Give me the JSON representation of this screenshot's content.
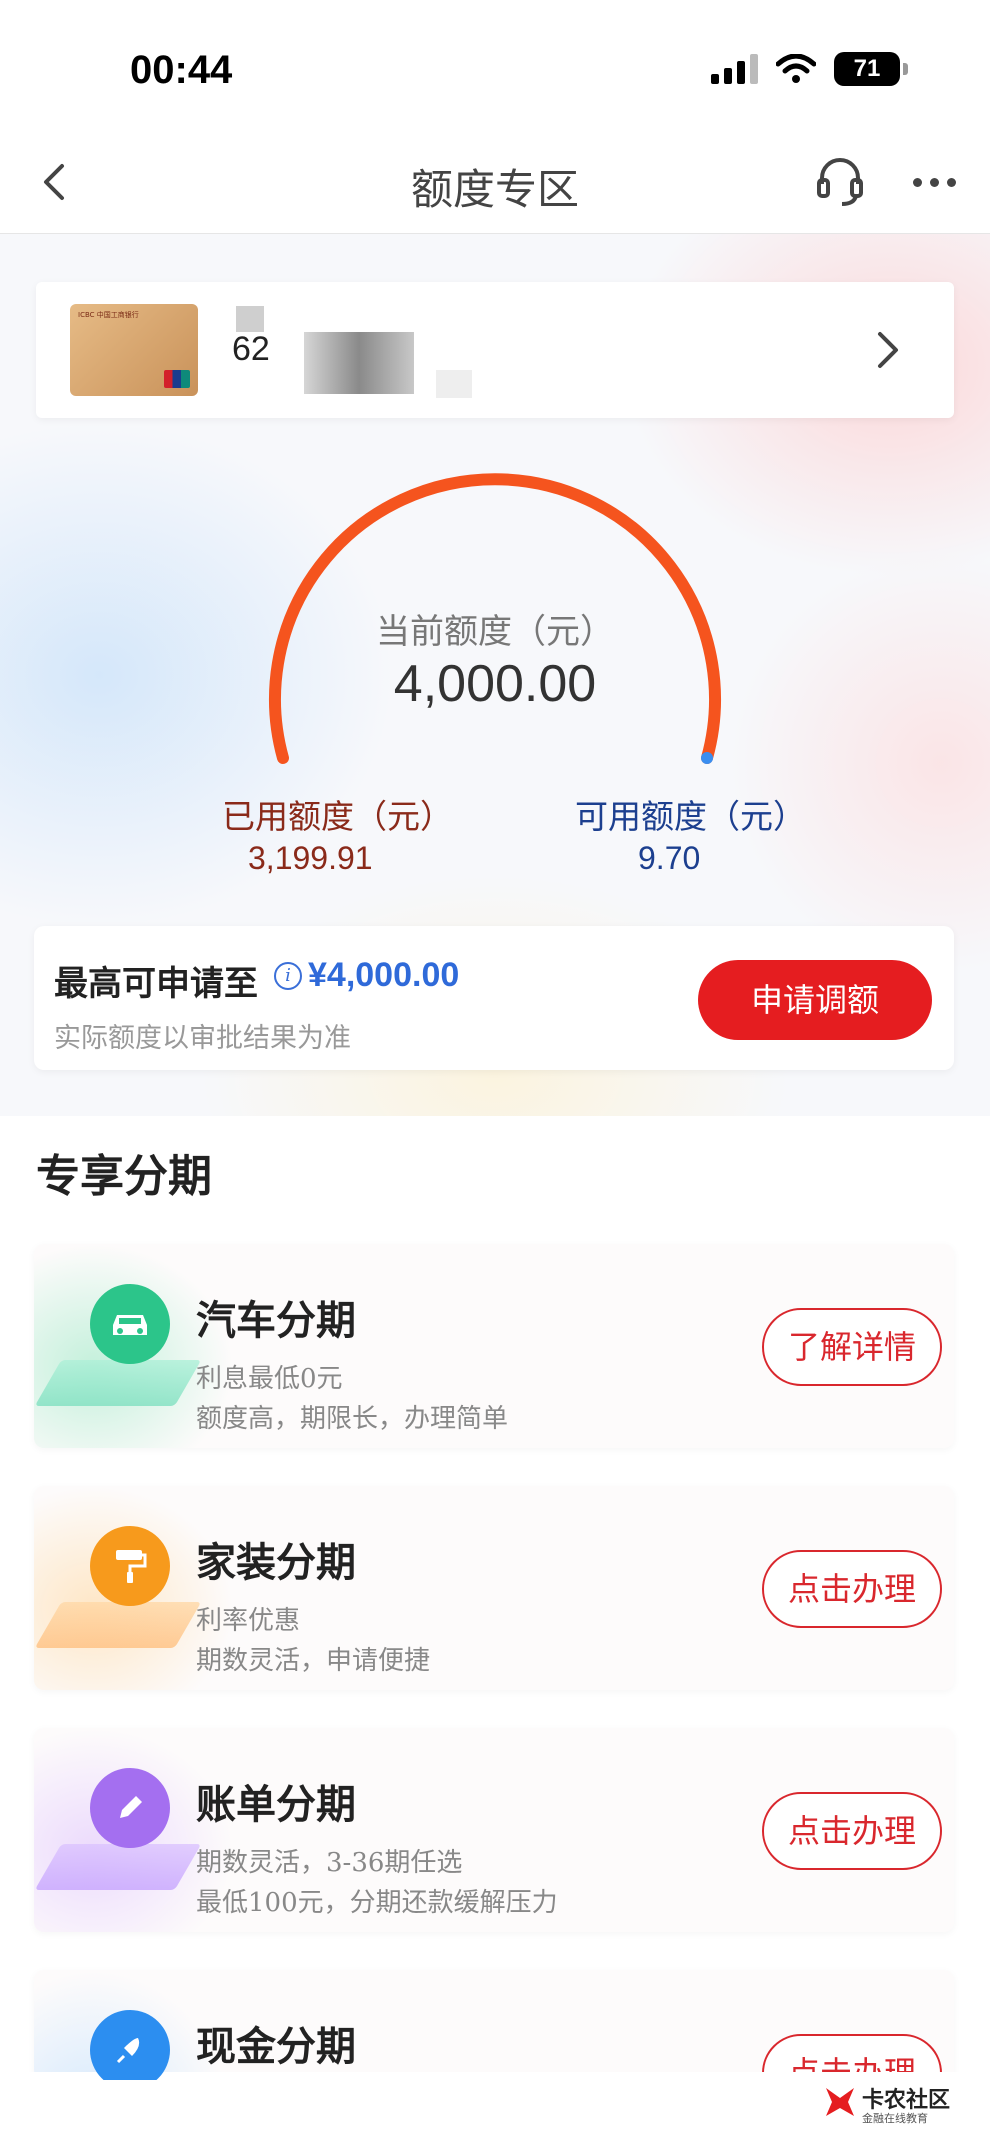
{
  "status_bar": {
    "time": "00:44",
    "battery": "71"
  },
  "nav": {
    "title": "额度专区"
  },
  "card": {
    "number_prefix": "62"
  },
  "limit": {
    "current_label": "当前额度（元）",
    "current_value": "4,000.00",
    "used_label": "已用额度（元）",
    "used_value": "3,199.91",
    "available_label": "可用额度（元）",
    "available_value": "9.70",
    "used_fraction": 0.8
  },
  "apply": {
    "title": "最高可申请至",
    "amount": "¥4,000.00",
    "note": "实际额度以审批结果为准",
    "button": "申请调额"
  },
  "section": {
    "title": "专享分期"
  },
  "plans": [
    {
      "name": "汽车分期",
      "line1": "利息最低0元",
      "line2": "额度高，期限长，办理简单",
      "button": "了解详情",
      "icon": "car-icon",
      "color": "#2cc58a"
    },
    {
      "name": "家装分期",
      "line1": "利率优惠",
      "line2": "期数灵活，申请便捷",
      "button": "点击办理",
      "icon": "paint-roller-icon",
      "color": "#f79a1c"
    },
    {
      "name": "账单分期",
      "line1": "期数灵活，3-36期任选",
      "line2": "最低100元，分期还款缓解压力",
      "button": "点击办理",
      "icon": "pencil-icon",
      "color": "#a46ff0"
    },
    {
      "name": "现金分期",
      "line1": "",
      "line2": "",
      "button": "点击办理",
      "icon": "rocket-icon",
      "color": "#2c8ef0"
    }
  ],
  "watermark": {
    "title": "卡农社区",
    "subtitle": "金融在线教育"
  },
  "colors": {
    "accent_red": "#e51d20",
    "arc_orange": "#f5541e",
    "used_text": "#8a2a1a",
    "available_text": "#1c3f8f",
    "link_blue": "#2f6ad9"
  }
}
